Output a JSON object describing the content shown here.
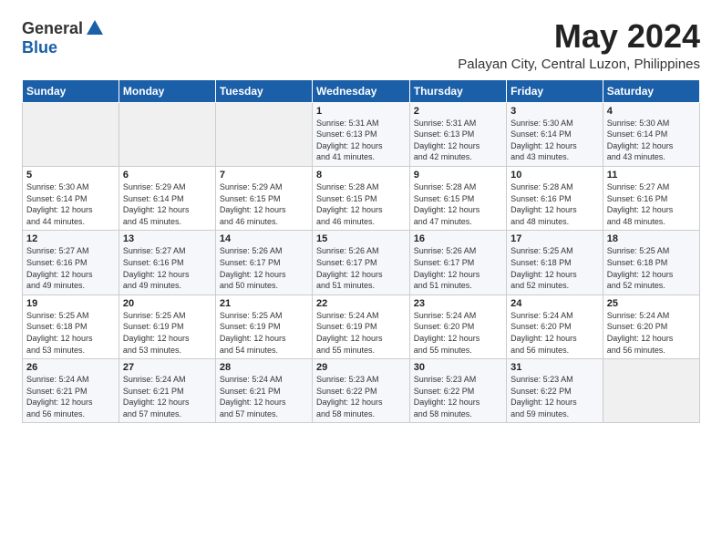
{
  "header": {
    "logo_general": "General",
    "logo_blue": "Blue",
    "month_title": "May 2024",
    "subtitle": "Palayan City, Central Luzon, Philippines"
  },
  "weekdays": [
    "Sunday",
    "Monday",
    "Tuesday",
    "Wednesday",
    "Thursday",
    "Friday",
    "Saturday"
  ],
  "weeks": [
    [
      {
        "day": "",
        "info": ""
      },
      {
        "day": "",
        "info": ""
      },
      {
        "day": "",
        "info": ""
      },
      {
        "day": "1",
        "info": "Sunrise: 5:31 AM\nSunset: 6:13 PM\nDaylight: 12 hours\nand 41 minutes."
      },
      {
        "day": "2",
        "info": "Sunrise: 5:31 AM\nSunset: 6:13 PM\nDaylight: 12 hours\nand 42 minutes."
      },
      {
        "day": "3",
        "info": "Sunrise: 5:30 AM\nSunset: 6:14 PM\nDaylight: 12 hours\nand 43 minutes."
      },
      {
        "day": "4",
        "info": "Sunrise: 5:30 AM\nSunset: 6:14 PM\nDaylight: 12 hours\nand 43 minutes."
      }
    ],
    [
      {
        "day": "5",
        "info": "Sunrise: 5:30 AM\nSunset: 6:14 PM\nDaylight: 12 hours\nand 44 minutes."
      },
      {
        "day": "6",
        "info": "Sunrise: 5:29 AM\nSunset: 6:14 PM\nDaylight: 12 hours\nand 45 minutes."
      },
      {
        "day": "7",
        "info": "Sunrise: 5:29 AM\nSunset: 6:15 PM\nDaylight: 12 hours\nand 46 minutes."
      },
      {
        "day": "8",
        "info": "Sunrise: 5:28 AM\nSunset: 6:15 PM\nDaylight: 12 hours\nand 46 minutes."
      },
      {
        "day": "9",
        "info": "Sunrise: 5:28 AM\nSunset: 6:15 PM\nDaylight: 12 hours\nand 47 minutes."
      },
      {
        "day": "10",
        "info": "Sunrise: 5:28 AM\nSunset: 6:16 PM\nDaylight: 12 hours\nand 48 minutes."
      },
      {
        "day": "11",
        "info": "Sunrise: 5:27 AM\nSunset: 6:16 PM\nDaylight: 12 hours\nand 48 minutes."
      }
    ],
    [
      {
        "day": "12",
        "info": "Sunrise: 5:27 AM\nSunset: 6:16 PM\nDaylight: 12 hours\nand 49 minutes."
      },
      {
        "day": "13",
        "info": "Sunrise: 5:27 AM\nSunset: 6:16 PM\nDaylight: 12 hours\nand 49 minutes."
      },
      {
        "day": "14",
        "info": "Sunrise: 5:26 AM\nSunset: 6:17 PM\nDaylight: 12 hours\nand 50 minutes."
      },
      {
        "day": "15",
        "info": "Sunrise: 5:26 AM\nSunset: 6:17 PM\nDaylight: 12 hours\nand 51 minutes."
      },
      {
        "day": "16",
        "info": "Sunrise: 5:26 AM\nSunset: 6:17 PM\nDaylight: 12 hours\nand 51 minutes."
      },
      {
        "day": "17",
        "info": "Sunrise: 5:25 AM\nSunset: 6:18 PM\nDaylight: 12 hours\nand 52 minutes."
      },
      {
        "day": "18",
        "info": "Sunrise: 5:25 AM\nSunset: 6:18 PM\nDaylight: 12 hours\nand 52 minutes."
      }
    ],
    [
      {
        "day": "19",
        "info": "Sunrise: 5:25 AM\nSunset: 6:18 PM\nDaylight: 12 hours\nand 53 minutes."
      },
      {
        "day": "20",
        "info": "Sunrise: 5:25 AM\nSunset: 6:19 PM\nDaylight: 12 hours\nand 53 minutes."
      },
      {
        "day": "21",
        "info": "Sunrise: 5:25 AM\nSunset: 6:19 PM\nDaylight: 12 hours\nand 54 minutes."
      },
      {
        "day": "22",
        "info": "Sunrise: 5:24 AM\nSunset: 6:19 PM\nDaylight: 12 hours\nand 55 minutes."
      },
      {
        "day": "23",
        "info": "Sunrise: 5:24 AM\nSunset: 6:20 PM\nDaylight: 12 hours\nand 55 minutes."
      },
      {
        "day": "24",
        "info": "Sunrise: 5:24 AM\nSunset: 6:20 PM\nDaylight: 12 hours\nand 56 minutes."
      },
      {
        "day": "25",
        "info": "Sunrise: 5:24 AM\nSunset: 6:20 PM\nDaylight: 12 hours\nand 56 minutes."
      }
    ],
    [
      {
        "day": "26",
        "info": "Sunrise: 5:24 AM\nSunset: 6:21 PM\nDaylight: 12 hours\nand 56 minutes."
      },
      {
        "day": "27",
        "info": "Sunrise: 5:24 AM\nSunset: 6:21 PM\nDaylight: 12 hours\nand 57 minutes."
      },
      {
        "day": "28",
        "info": "Sunrise: 5:24 AM\nSunset: 6:21 PM\nDaylight: 12 hours\nand 57 minutes."
      },
      {
        "day": "29",
        "info": "Sunrise: 5:23 AM\nSunset: 6:22 PM\nDaylight: 12 hours\nand 58 minutes."
      },
      {
        "day": "30",
        "info": "Sunrise: 5:23 AM\nSunset: 6:22 PM\nDaylight: 12 hours\nand 58 minutes."
      },
      {
        "day": "31",
        "info": "Sunrise: 5:23 AM\nSunset: 6:22 PM\nDaylight: 12 hours\nand 59 minutes."
      },
      {
        "day": "",
        "info": ""
      }
    ]
  ]
}
